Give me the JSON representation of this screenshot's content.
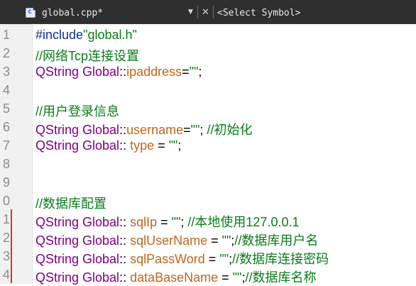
{
  "tab": {
    "title": "global.cpp*",
    "icon": "cpp-file-icon",
    "dropdown_glyph": "▼",
    "close_glyph": "✕"
  },
  "symbol_selector": {
    "value": "<Select Symbol>"
  },
  "lines": [
    {
      "num": "1",
      "changed": false,
      "tokens": [
        {
          "t": "kw",
          "v": "#include"
        },
        {
          "t": "str",
          "v": "\"global.h\""
        }
      ]
    },
    {
      "num": "2",
      "changed": false,
      "tokens": [
        {
          "t": "com",
          "v": "//网络Tcp连接设置"
        }
      ]
    },
    {
      "num": "3",
      "changed": false,
      "tokens": [
        {
          "t": "type",
          "v": "QString Global"
        },
        {
          "t": "op",
          "v": "::"
        },
        {
          "t": "mem",
          "v": "ipaddress"
        },
        {
          "t": "op",
          "v": "="
        },
        {
          "t": "str",
          "v": "\"\""
        },
        {
          "t": "op",
          "v": ";"
        }
      ]
    },
    {
      "num": "4",
      "changed": false,
      "tokens": []
    },
    {
      "num": "5",
      "changed": false,
      "tokens": [
        {
          "t": "com",
          "v": "//用户登录信息"
        }
      ]
    },
    {
      "num": "6",
      "changed": false,
      "tokens": [
        {
          "t": "type",
          "v": "QString Global"
        },
        {
          "t": "op",
          "v": "::"
        },
        {
          "t": "mem",
          "v": "username"
        },
        {
          "t": "op",
          "v": "="
        },
        {
          "t": "str",
          "v": "\"\""
        },
        {
          "t": "op",
          "v": "; "
        },
        {
          "t": "com",
          "v": "//初始化"
        }
      ]
    },
    {
      "num": "7",
      "changed": false,
      "tokens": [
        {
          "t": "type",
          "v": "QString Global"
        },
        {
          "t": "op",
          "v": ":: "
        },
        {
          "t": "mem",
          "v": "type"
        },
        {
          "t": "op",
          "v": " = "
        },
        {
          "t": "str",
          "v": "\"\""
        },
        {
          "t": "op",
          "v": ";"
        }
      ]
    },
    {
      "num": "8",
      "changed": false,
      "tokens": []
    },
    {
      "num": "9",
      "changed": false,
      "tokens": []
    },
    {
      "num": "0",
      "changed": false,
      "tokens": [
        {
          "t": "com",
          "v": "//数据库配置"
        }
      ]
    },
    {
      "num": "1",
      "changed": true,
      "tokens": [
        {
          "t": "type",
          "v": "QString Global"
        },
        {
          "t": "op",
          "v": ":: "
        },
        {
          "t": "mem",
          "v": "sqlIp"
        },
        {
          "t": "op",
          "v": " = "
        },
        {
          "t": "str",
          "v": "\"\""
        },
        {
          "t": "op",
          "v": "; "
        },
        {
          "t": "com",
          "v": "//本地使用127.0.0.1"
        }
      ]
    },
    {
      "num": "2",
      "changed": true,
      "tokens": [
        {
          "t": "type",
          "v": "QString Global"
        },
        {
          "t": "op",
          "v": ":: "
        },
        {
          "t": "mem",
          "v": "sqlUserName"
        },
        {
          "t": "op",
          "v": " = "
        },
        {
          "t": "str",
          "v": "\"\""
        },
        {
          "t": "op",
          "v": ";"
        },
        {
          "t": "com",
          "v": "//数据库用户名"
        }
      ]
    },
    {
      "num": "3",
      "changed": true,
      "tokens": [
        {
          "t": "type",
          "v": "QString Global"
        },
        {
          "t": "op",
          "v": ":: "
        },
        {
          "t": "mem",
          "v": "sqlPassWord"
        },
        {
          "t": "op",
          "v": " = "
        },
        {
          "t": "str",
          "v": "\"\""
        },
        {
          "t": "op",
          "v": ";"
        },
        {
          "t": "com",
          "v": "//数据库连接密码"
        }
      ]
    },
    {
      "num": "4",
      "changed": true,
      "tokens": [
        {
          "t": "type",
          "v": "QString Global"
        },
        {
          "t": "op",
          "v": ":: "
        },
        {
          "t": "mem",
          "v": "dataBaseName"
        },
        {
          "t": "op",
          "v": " = "
        },
        {
          "t": "str",
          "v": "\"\""
        },
        {
          "t": "op",
          "v": ";"
        },
        {
          "t": "com",
          "v": "//数据库名称"
        }
      ]
    }
  ],
  "colors": {
    "keyword": "#0f2f8f",
    "string": "#0a7b1a",
    "comment": "#0a7b1a",
    "type": "#800080",
    "member": "#c0661e",
    "change_marker": "#e3302f",
    "tabbar_bg": "#2f2f2f"
  }
}
